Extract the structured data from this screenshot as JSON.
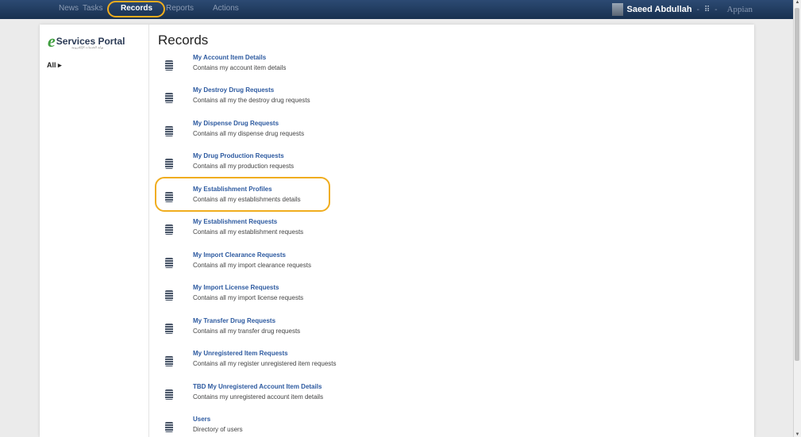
{
  "nav": {
    "items": [
      "News",
      "Tasks",
      "Records",
      "Reports",
      "Actions"
    ],
    "active": "Records"
  },
  "user": {
    "name": "Saeed Abdullah",
    "separator": "-",
    "grid": "⠿",
    "brand": "Appian"
  },
  "sidebar": {
    "logo_text": "Services Portal",
    "logo_sub": "بوابة الخدمات الإلكترونية",
    "filter": "All ▸"
  },
  "page": {
    "title": "Records"
  },
  "records": [
    {
      "title": "My Account Item Details",
      "desc": "Contains my account item details"
    },
    {
      "title": "My Destroy Drug Requests",
      "desc": "Contains all my the destroy drug requests"
    },
    {
      "title": "My Dispense Drug Requests",
      "desc": "Contains all my dispense drug requests"
    },
    {
      "title": "My Drug Production Requests",
      "desc": "Contains all my production requests"
    },
    {
      "title": "My Establishment Profiles",
      "desc": "Contains all my establishments details"
    },
    {
      "title": "My Establishment Requests",
      "desc": "Contains all my establishment requests"
    },
    {
      "title": "My Import Clearance Requests",
      "desc": "Contains all my import clearance requests"
    },
    {
      "title": "My Import License Requests",
      "desc": "Contains all my import license requests"
    },
    {
      "title": "My Transfer Drug Requests",
      "desc": "Contains all my transfer drug requests"
    },
    {
      "title": "My Unregistered Item Requests",
      "desc": "Contains all my register unregistered item requests"
    },
    {
      "title": "TBD My Unregistered Account Item Details",
      "desc": "Contains my unregistered account item details"
    },
    {
      "title": "Users",
      "desc": "Directory of users"
    }
  ],
  "colors": {
    "topbar": "#1d3557",
    "link": "#2d5aa0",
    "highlight": "#f0ad1e",
    "logo_green": "#3f9e3f"
  }
}
